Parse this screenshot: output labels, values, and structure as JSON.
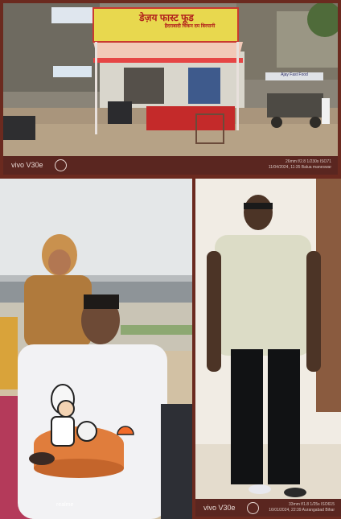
{
  "top_photo": {
    "sign_main": "डेज़य फास्ट फूड",
    "sign_sub": "हैदराबादी चिकन दम बिरयानी",
    "side_sign": "Ajay Fast Food",
    "camera_brand": "vivo V30e",
    "camera_meta_line1": "26mm f/2.8 1/230s ISO71",
    "camera_meta_line2": "11/04/2024, 11:35 Balua maneswar"
  },
  "left_photo": {
    "watermark": "realme"
  },
  "right_photo": {
    "camera_brand": "vivo V30e",
    "camera_meta_line1": "33mm f/1.8 1/25s ISO615",
    "camera_meta_line2": "16/01/2024, 22:39 Aurangabad Bihar"
  },
  "colors": {
    "frame": "#6b2a1f",
    "camera_bar": "#5a2620",
    "badge_fill": "#e07d3c"
  }
}
